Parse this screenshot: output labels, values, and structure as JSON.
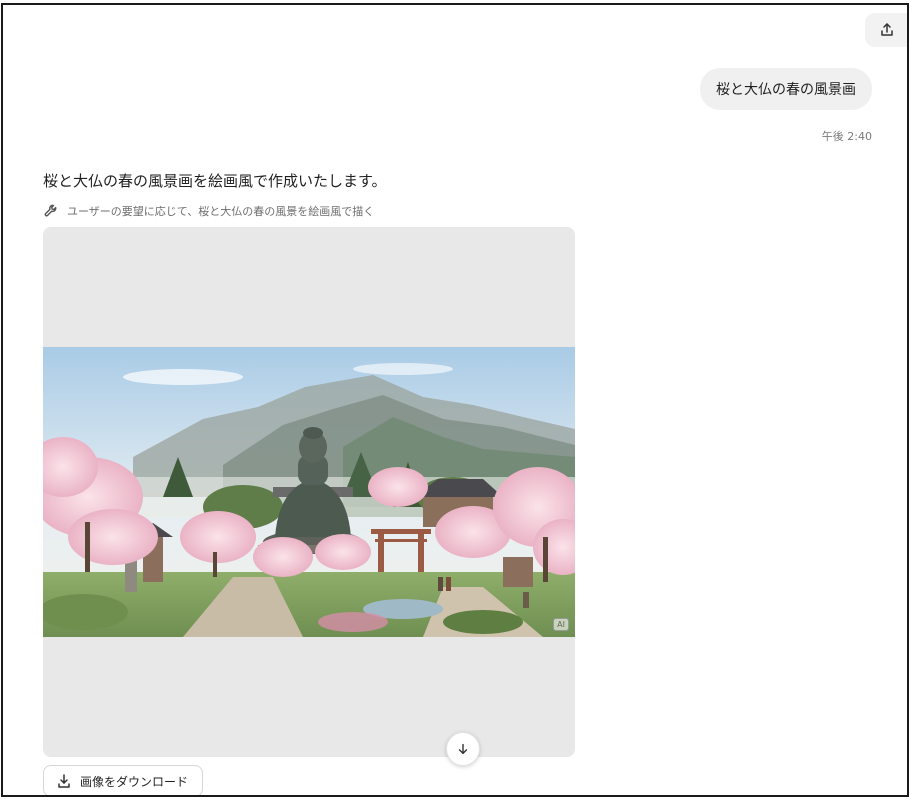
{
  "header": {
    "share_icon": "share-upload-icon"
  },
  "chat": {
    "user_message": "桜と大仏の春の風景画",
    "timestamp": "午後 2:40",
    "assistant_reply": "桜と大仏の春の風景画を絵画風で作成いたします。",
    "tool_call": {
      "icon": "wrench-icon",
      "description": "ユーザーの要望に応じて、桜と大仏の春の風景を絵画風で描く"
    },
    "image": {
      "badge": "AI"
    },
    "download_label": "画像をダウンロード",
    "scroll_icon": "arrow-down-icon"
  },
  "colors": {
    "bubble_bg": "#f0f0f0",
    "image_placeholder_bg": "#e8e8e8",
    "text_primary": "#1f1f1f",
    "text_muted": "#6e6e6e"
  }
}
